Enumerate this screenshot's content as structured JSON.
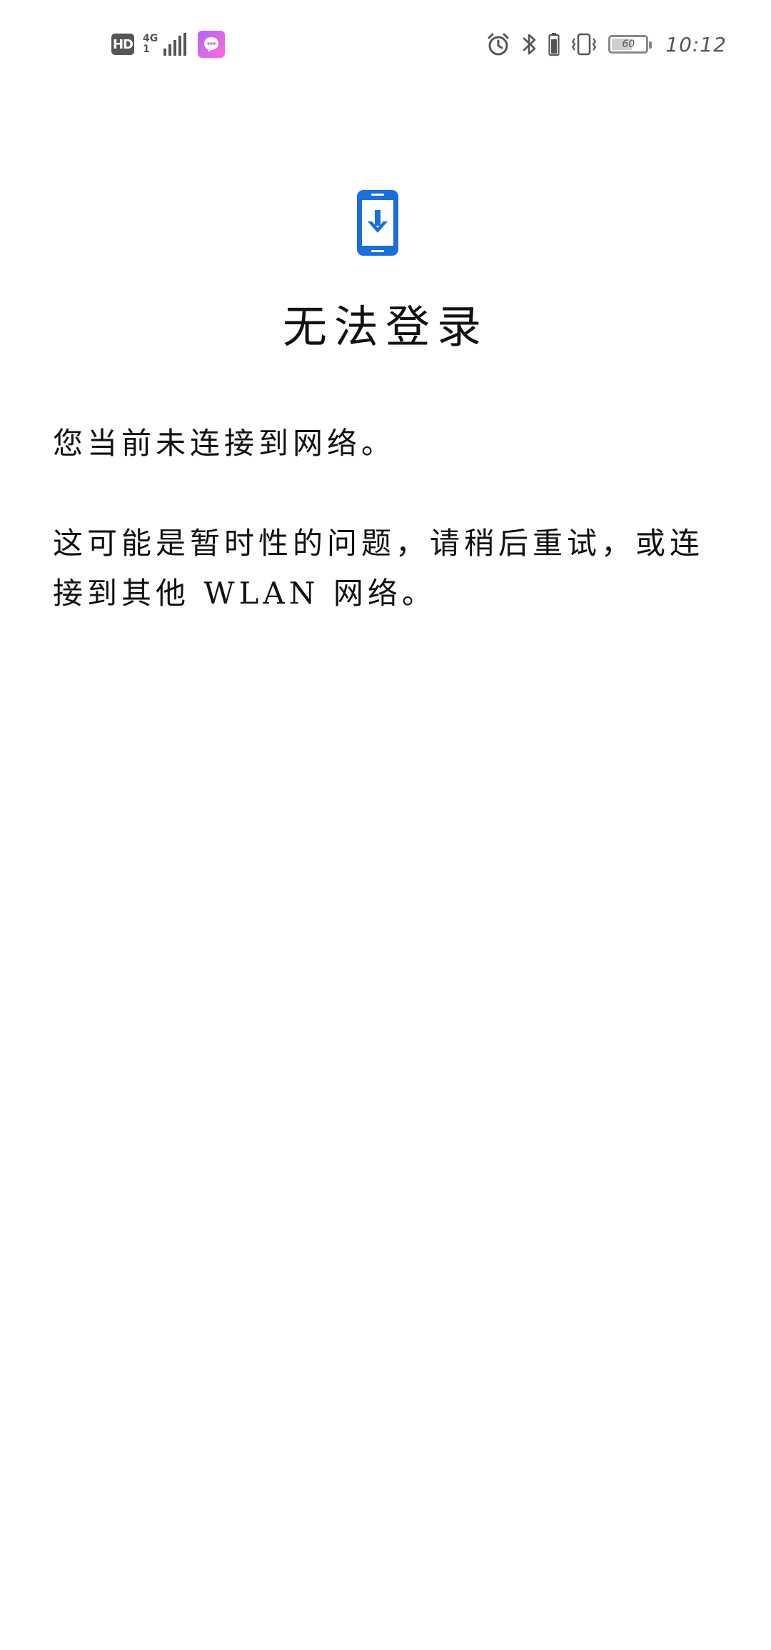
{
  "status_bar": {
    "hd_label": "HD",
    "network_type": "4G",
    "network_sub": "1",
    "notification_icon": "chat-bubble-icon",
    "icons": [
      "alarm-icon",
      "bluetooth-icon",
      "vibrate-icon"
    ],
    "battery_level": "60",
    "battery_fraction": 0.6,
    "time": "10:12"
  },
  "main": {
    "icon": "phone-download-icon",
    "accent_color": "#1b6fd8",
    "title": "无法登录",
    "message_line1": "您当前未连接到网络。",
    "message_line2": "这可能是暂时性的问题，请稍后重试，或连接到其他 WLAN 网络。"
  }
}
